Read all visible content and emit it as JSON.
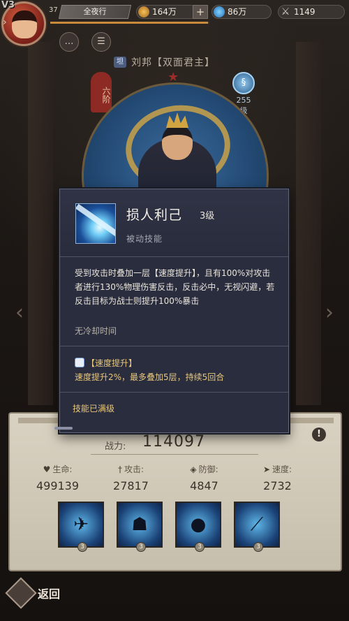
{
  "player": {
    "vip": "V3",
    "level": "37",
    "name": "全夜行",
    "xp_fraction": 0.99
  },
  "resources": {
    "gold": "164万",
    "gems": "86万",
    "power": "1149",
    "plus_label": "+"
  },
  "toolbar": {
    "chat_icon": "chat-icon",
    "notes_icon": "notes-icon"
  },
  "hero": {
    "tag": "坦",
    "name": "刘邦【双面君主】",
    "rank": "六阶",
    "level_num": "255",
    "level_unit": "级"
  },
  "popup": {
    "skill_name": "损人利己",
    "skill_level": "3级",
    "skill_type": "被动技能",
    "description": "受到攻击时叠加一层【速度提升】，且有100%对攻击者进行130%物理伤害反击，反击必中，无视闪避，若反击目标为战士则提升100%暴击",
    "cooldown": "无冷却时间",
    "buff_title": "【速度提升】",
    "buff_desc": "速度提升2%，最多叠加5层，持续5回合",
    "maxed": "技能已满级"
  },
  "panel": {
    "power_label": "战力:",
    "power_value": "114097",
    "stats": [
      {
        "label": "生命:",
        "value": "499139",
        "icon": "heart-icon"
      },
      {
        "label": "攻击:",
        "value": "27817",
        "icon": "sword-icon"
      },
      {
        "label": "防御:",
        "value": "4847",
        "icon": "shield-icon"
      },
      {
        "label": "速度:",
        "value": "2732",
        "icon": "boot-icon"
      }
    ],
    "skills": [
      {
        "level": "3",
        "icon": "cannon-skill-icon"
      },
      {
        "level": "3",
        "icon": "ninja-skill-icon"
      },
      {
        "level": "3",
        "icon": "shadow-skill-icon"
      },
      {
        "level": "3",
        "icon": "slash-skill-icon"
      }
    ]
  },
  "back": {
    "label": "返回"
  }
}
